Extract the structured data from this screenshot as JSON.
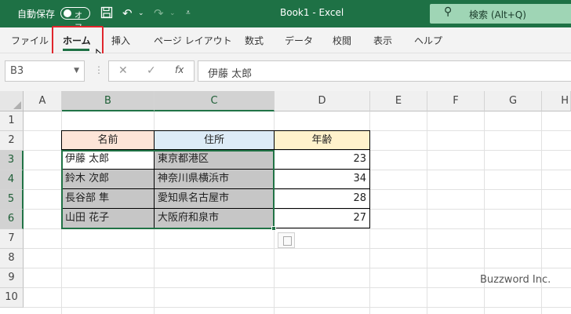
{
  "titlebar": {
    "autosave_label": "自動保存",
    "autosave_state": "オフ",
    "save_icon": "save-icon",
    "undo_icon": "undo-icon",
    "redo_icon": "redo-icon",
    "customize_icon": "customize-qat-icon",
    "title": "Book1  -  Excel",
    "search_label": "検索 (Alt+Q)",
    "accent": "#1e7145"
  },
  "ribbon": {
    "tabs": [
      "ファイル",
      "ホーム",
      "挿入",
      "ページ レイアウト",
      "数式",
      "データ",
      "校閲",
      "表示",
      "ヘルプ"
    ],
    "active_tab": "ホーム",
    "highlight_color": "#e0262c"
  },
  "formula_bar": {
    "name_box": "B3",
    "cancel_icon": "✕",
    "enter_icon": "✓",
    "fx_label": "fx",
    "value": "伊藤 太郎"
  },
  "sheet": {
    "columns": [
      "A",
      "B",
      "C",
      "D",
      "E",
      "F",
      "G",
      "H"
    ],
    "rows": [
      "1",
      "2",
      "3",
      "4",
      "5",
      "6",
      "7",
      "8",
      "9",
      "10"
    ],
    "header": {
      "name": "名前",
      "address": "住所",
      "age": "年齢"
    },
    "records": [
      {
        "name": "伊藤 太郎",
        "address": "東京都港区",
        "age": "23"
      },
      {
        "name": "鈴木 次郎",
        "address": "神奈川県横浜市",
        "age": "34"
      },
      {
        "name": "長谷部 隼",
        "address": "愛知県名古屋市",
        "age": "28"
      },
      {
        "name": "山田 花子",
        "address": "大阪府和泉市",
        "age": "27"
      }
    ],
    "header_colors": {
      "name": "#fde4d8",
      "address": "#ddebf7",
      "age": "#fff2cc"
    },
    "selection_range": "B3:C6"
  },
  "watermark": "Buzzword Inc."
}
